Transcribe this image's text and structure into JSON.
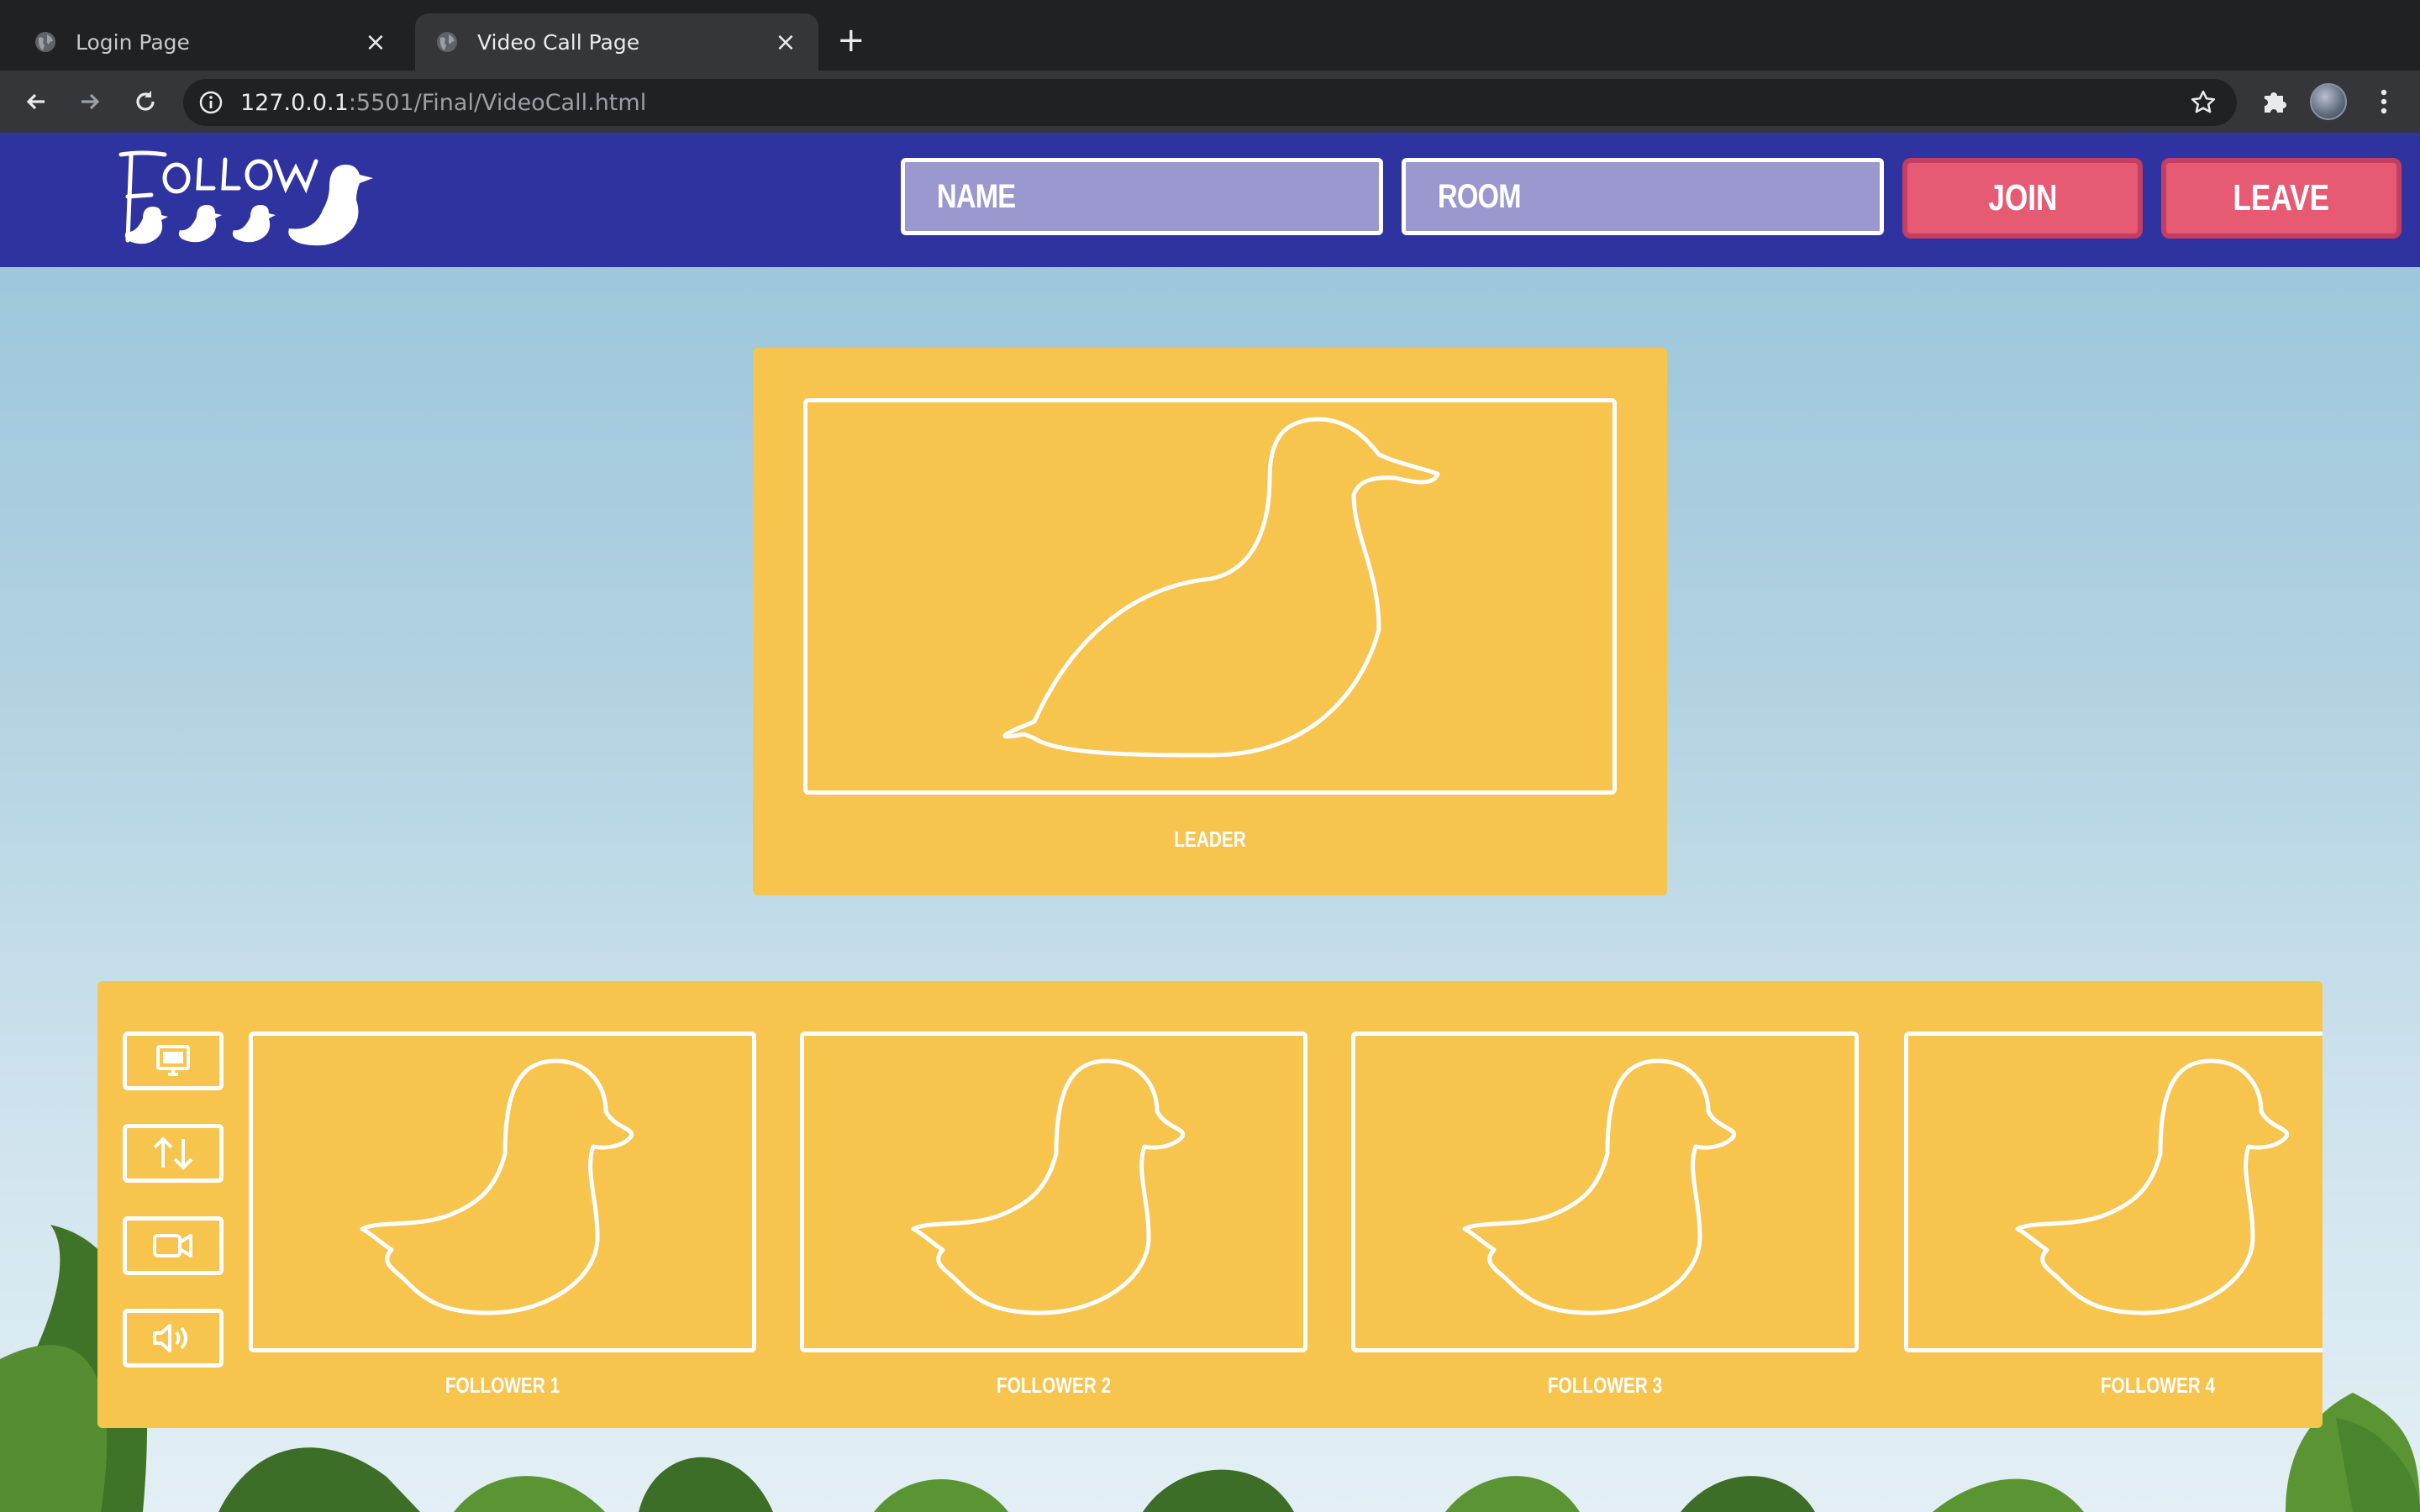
{
  "browser": {
    "tabs": [
      {
        "title": "Login Page",
        "active": false
      },
      {
        "title": "Video Call Page",
        "active": true
      }
    ],
    "url_host": "127.0.0.1",
    "url_path": ":5501/Final/VideoCall.html"
  },
  "header": {
    "logo_text": "FOLLOW",
    "name_placeholder": "NAME",
    "room_placeholder": "ROOM",
    "join_label": "JOIN",
    "leave_label": "LEAVE"
  },
  "leader": {
    "label": "LEADER"
  },
  "controls": [
    {
      "icon": "monitor-icon"
    },
    {
      "icon": "swap-icon"
    },
    {
      "icon": "video-camera-icon"
    },
    {
      "icon": "speaker-icon"
    }
  ],
  "followers": [
    {
      "label": "FOLLOWER 1"
    },
    {
      "label": "FOLLOWER 2"
    },
    {
      "label": "FOLLOWER 3"
    },
    {
      "label": "FOLLOWER 4"
    }
  ],
  "colors": {
    "header_bg": "#2e33a0",
    "panel_bg": "#f7c44e",
    "button_bg": "#e65b73",
    "input_bg": "#9b98d0"
  }
}
